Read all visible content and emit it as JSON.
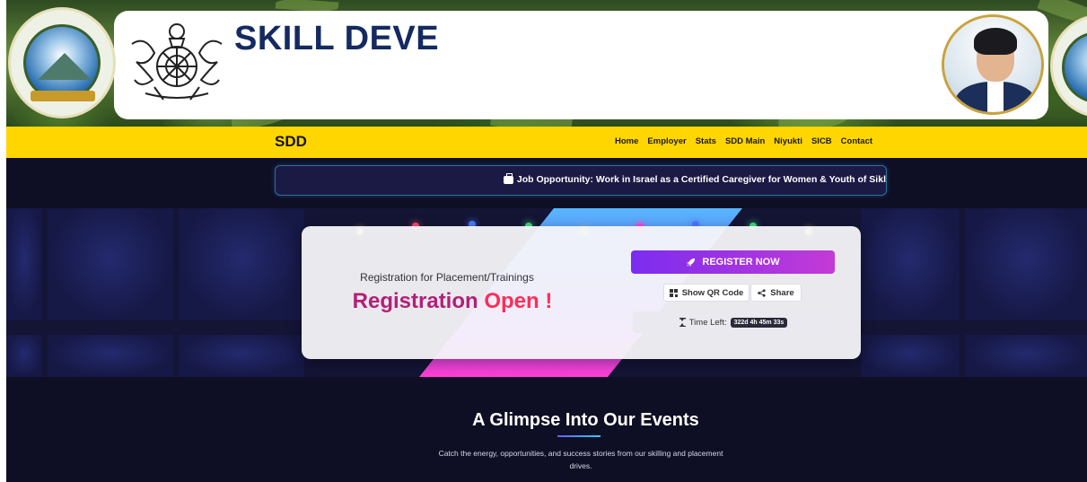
{
  "header": {
    "title": "SKILL DEVE",
    "icons": [
      "left-state-seal-icon",
      "emblem-icon",
      "portrait-image",
      "right-state-seal-icon"
    ]
  },
  "nav": {
    "brand": "SDD",
    "links": [
      "Home",
      "Employer",
      "Stats",
      "SDD Main",
      "Niyukti",
      "SICB",
      "Contact"
    ]
  },
  "ticker": {
    "text": "Job Opportunity: Work in Israel as a Certified Caregiver for Women & Youth of Sikl",
    "icon": "briefcase-icon"
  },
  "registration": {
    "subtitle": "Registration for Placement/Trainings",
    "title_word1": "Registration",
    "title_word2": "Open !",
    "register_button": "REGISTER NOW",
    "qr_button": "Show QR Code",
    "share_button": "Share",
    "time_left_label": "Time Left:",
    "time_left_value": "322d 4h 45m 33s"
  },
  "events": {
    "title": "A Glimpse Into Our Events",
    "description": "Catch the energy, opportunities, and success stories from our skilling and placement drives."
  },
  "colors": {
    "nav_bg": "#ffd600",
    "page_bg": "#0e0e24",
    "title_navy": "#142a61",
    "register_gradient_start": "#7b2cf0",
    "register_gradient_end": "#c43ad6",
    "registration_pink": "#b41f78",
    "registration_red": "#ff2d58"
  }
}
